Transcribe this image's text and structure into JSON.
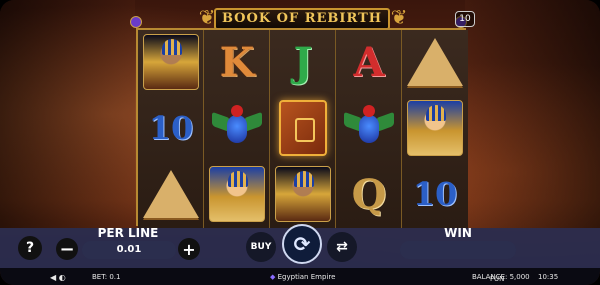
{
  "game": {
    "title": "BOOK OF REBIRTH",
    "lines_count": "10"
  },
  "reels": [
    [
      {
        "symbol": "queen-portrait"
      },
      {
        "symbol": "10",
        "label": "10"
      },
      {
        "symbol": "pyramid"
      }
    ],
    [
      {
        "symbol": "K",
        "label": "K"
      },
      {
        "symbol": "scarab"
      },
      {
        "symbol": "pharaoh-portrait"
      }
    ],
    [
      {
        "symbol": "J",
        "label": "J"
      },
      {
        "symbol": "book"
      },
      {
        "symbol": "queen-portrait"
      }
    ],
    [
      {
        "symbol": "A",
        "label": "A"
      },
      {
        "symbol": "scarab"
      },
      {
        "symbol": "Q",
        "label": "Q"
      }
    ],
    [
      {
        "symbol": "pyramid"
      },
      {
        "symbol": "pharaoh-portrait"
      },
      {
        "symbol": "10",
        "label": "10"
      }
    ]
  ],
  "controls": {
    "help_label": "?",
    "per_line_label": "PER LINE",
    "bet_value": "0.01",
    "minus_label": "−",
    "plus_label": "+",
    "buy_label": "BUY",
    "spin_icon": "spin-icon",
    "autoplay_icon": "autoplay-icon",
    "win_label": "WIN",
    "win_value": ""
  },
  "status": {
    "bet": "BET: 0.1",
    "game_name": "Egyptian Empire",
    "balance": "BALANCE: 5,000",
    "mode": "FUN",
    "time": "10:35"
  },
  "colors": {
    "frame_gold": "#c9952f",
    "control_bar": "#282d50",
    "title_text": "#f0c55a"
  }
}
